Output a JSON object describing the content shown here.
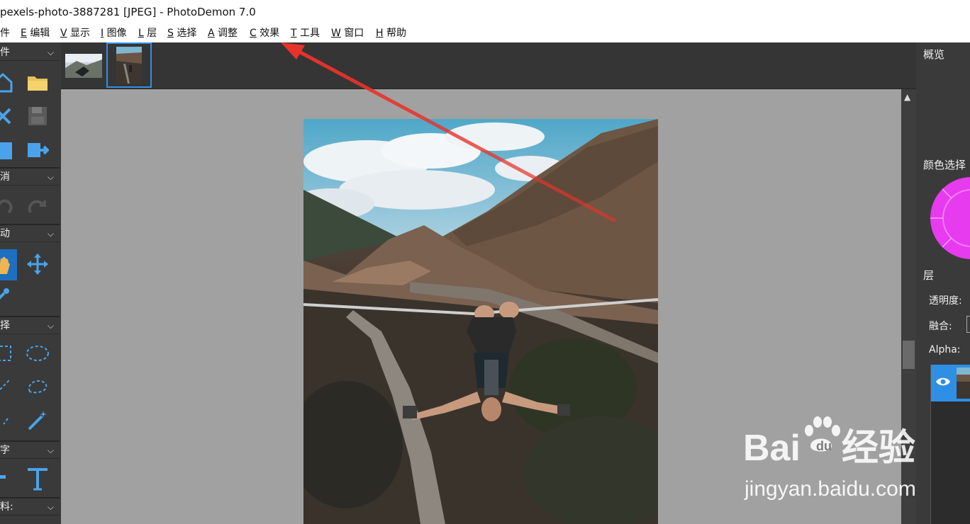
{
  "window": {
    "title": "pexels-photo-3887281 [JPEG]  -  PhotoDemon 7.0"
  },
  "menu": [
    {
      "key": "",
      "label": "件"
    },
    {
      "key": "E",
      "label": "编辑"
    },
    {
      "key": "V",
      "label": "显示"
    },
    {
      "key": "I",
      "label": "图像"
    },
    {
      "key": "L",
      "label": "层"
    },
    {
      "key": "S",
      "label": "选择"
    },
    {
      "key": "A",
      "label": "调整"
    },
    {
      "key": "C",
      "label": "效果"
    },
    {
      "key": "T",
      "label": "工具"
    },
    {
      "key": "W",
      "label": "窗口"
    },
    {
      "key": "H",
      "label": "帮助"
    }
  ],
  "left_toolbox": {
    "sections": [
      {
        "label": "件"
      },
      {
        "label": "消"
      },
      {
        "label": "动"
      },
      {
        "label": "择"
      },
      {
        "label": "字"
      },
      {
        "label": "料:"
      }
    ]
  },
  "right_panel": {
    "overview_title": "概览",
    "color_title": "颜色选择",
    "layers_title": "层",
    "opacity_label": "透明度:",
    "blend_label": "融合:",
    "alpha_label": "Alpha:"
  },
  "watermark": {
    "brand": "Bai",
    "brand_suffix": "经验",
    "url": "jingyan.baidu.com"
  },
  "colors": {
    "accent": "#2f8fe4",
    "arrow": "#e8322a",
    "canvas_bg": "#a1a1a1",
    "panel_bg": "#3a3a3a",
    "color_wheel": "#e63bef"
  }
}
